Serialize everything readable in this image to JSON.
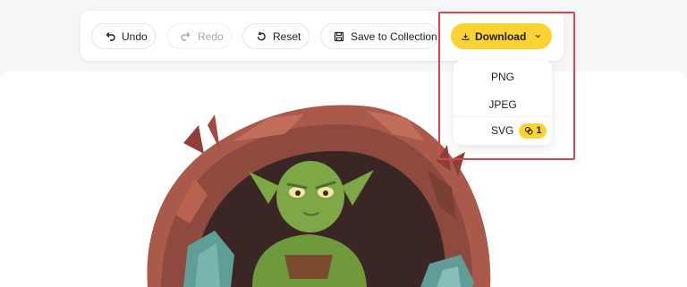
{
  "toolbar": {
    "undo_label": "Undo",
    "redo_label": "Redo",
    "reset_label": "Reset",
    "save_label": "Save to Collection",
    "download_label": "Download"
  },
  "download_menu": {
    "options": [
      {
        "label": "PNG"
      },
      {
        "label": "JPEG"
      },
      {
        "label": "SVG",
        "credit_cost": "1"
      }
    ]
  },
  "colors": {
    "accent": "#fcd332",
    "highlight": "#d9464e",
    "page_bg": "#f5f6f8",
    "canvas_bg": "#ffffff"
  },
  "icons": [
    "undo-icon",
    "redo-icon",
    "reset-icon",
    "save-icon",
    "download-icon",
    "chevron-down-icon",
    "credit-icon"
  ]
}
